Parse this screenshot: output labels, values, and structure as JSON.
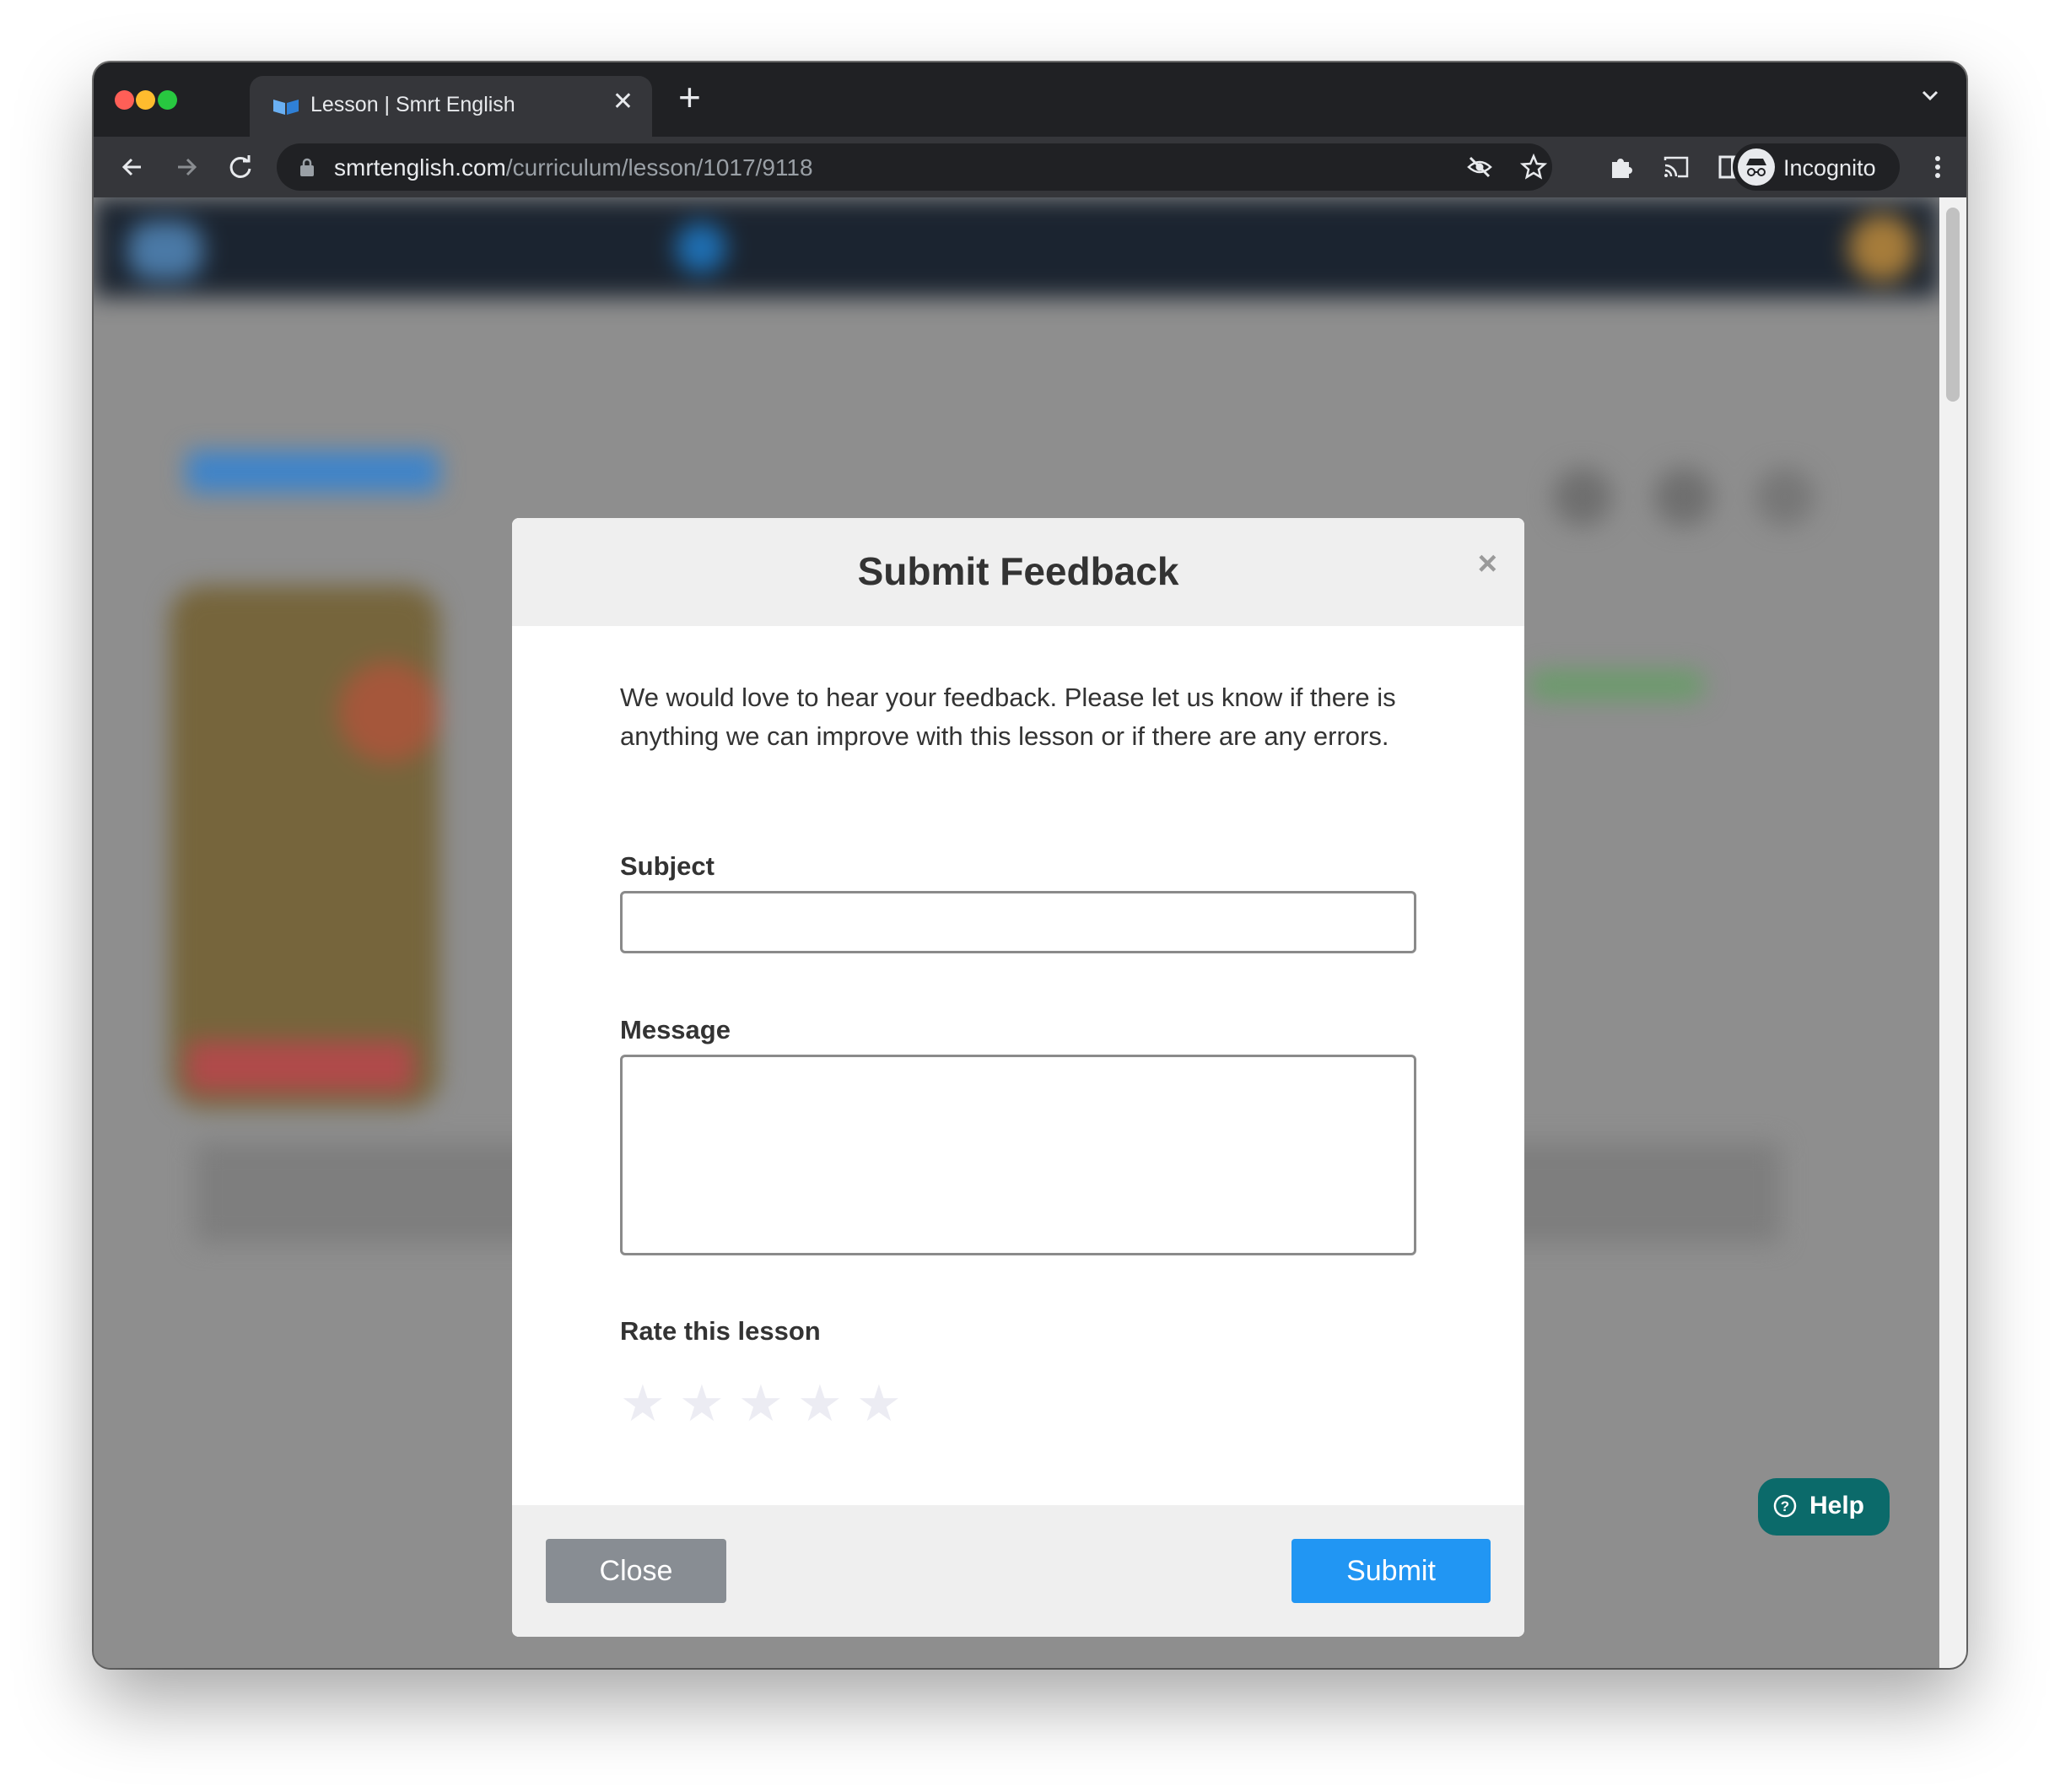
{
  "browser": {
    "tab_title": "Lesson | Smrt English",
    "url_host": "smrtenglish.com",
    "url_path": "/curriculum/lesson/1017/9118",
    "profile_label": "Incognito",
    "icons": [
      "back-arrow-icon",
      "forward-arrow-icon",
      "reload-icon",
      "lock-icon",
      "eye-off-icon",
      "star-icon",
      "extensions-puzzle-icon",
      "cast-icon",
      "side-panel-icon",
      "incognito-icon",
      "more-vert-icon",
      "tab-search-chevron-icon",
      "new-tab-plus-icon",
      "tab-close-icon"
    ]
  },
  "modal": {
    "title": "Submit Feedback",
    "close_x": "×",
    "intro": "We would love to hear your feedback. Please let us know if there is anything we can improve with this lesson or if there are any errors.",
    "subject_label": "Subject",
    "subject_value": "",
    "message_label": "Message",
    "message_value": "",
    "rating_label": "Rate this lesson",
    "rating_value": 0,
    "rating_max": 5,
    "close_button": "Close",
    "submit_button": "Submit"
  },
  "help": {
    "label": "Help"
  },
  "colors": {
    "submit": "#2196f3",
    "close": "#888d93",
    "help": "#0b6a6a",
    "star_empty": "#ececf3",
    "traffic_red": "#ff5f57",
    "traffic_yellow": "#febc2e",
    "traffic_green": "#28c840"
  }
}
